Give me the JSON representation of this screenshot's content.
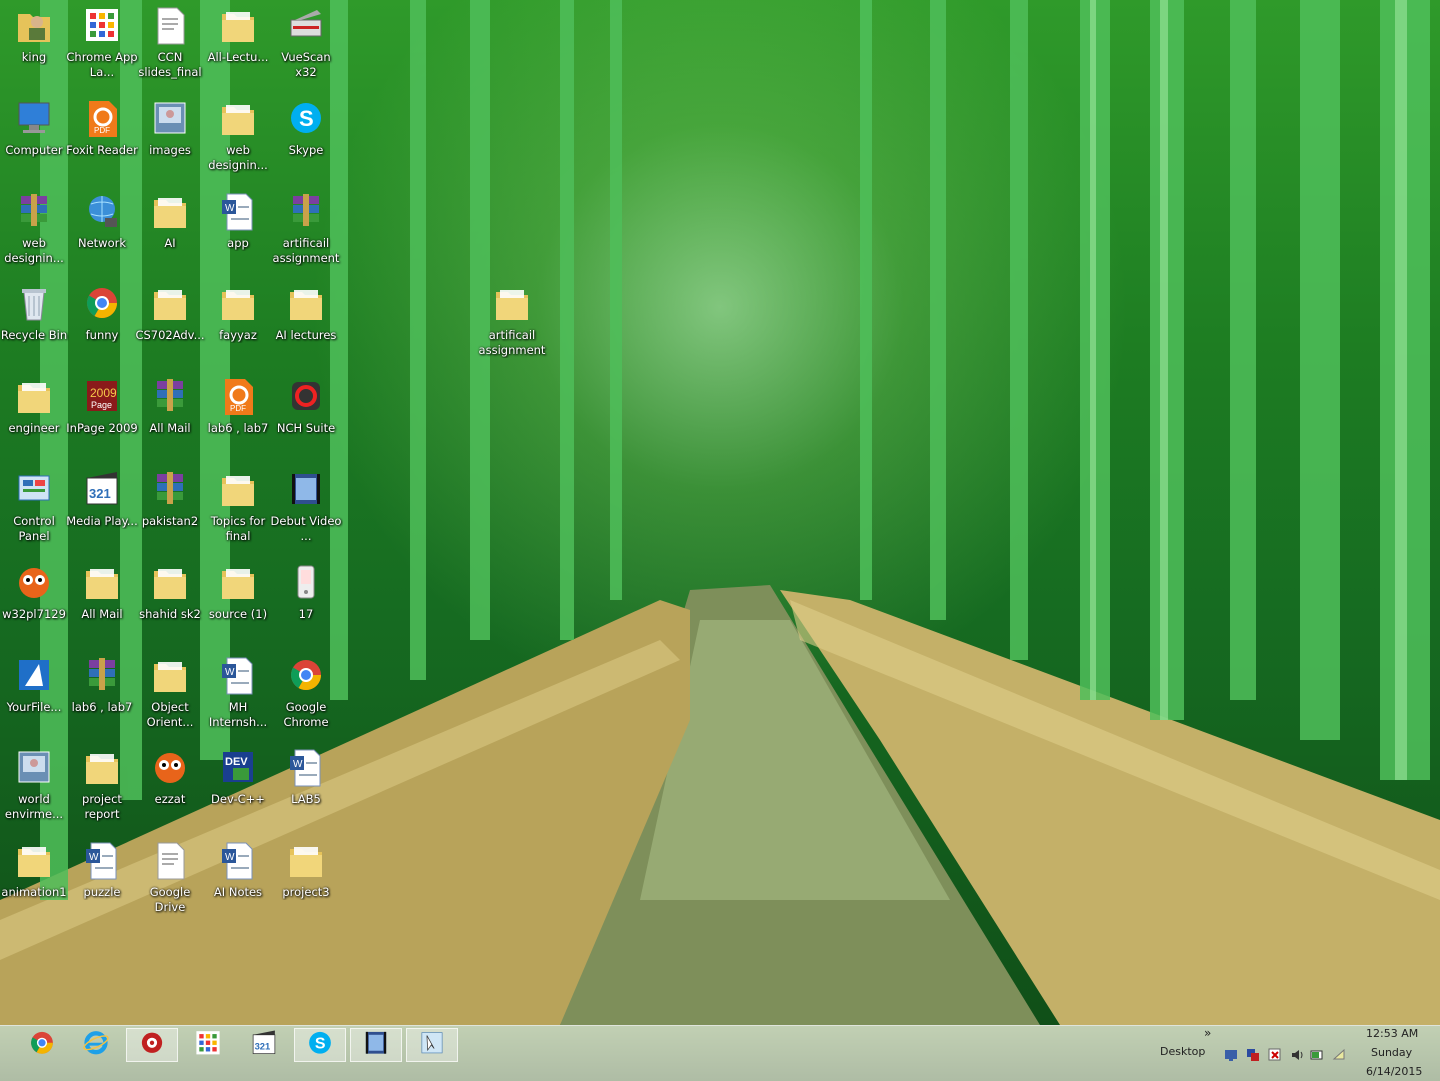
{
  "desktop_icons": [
    {
      "label": "king",
      "icon": "user-folder-icon"
    },
    {
      "label": "Chrome App La...",
      "icon": "chrome-apps-icon"
    },
    {
      "label": "CCN slides_final",
      "icon": "document-icon"
    },
    {
      "label": "All-Lectu...",
      "icon": "folder-icon"
    },
    {
      "label": "VueScan x32",
      "icon": "scanner-icon"
    },
    {
      "label": "Computer",
      "icon": "computer-icon"
    },
    {
      "label": "Foxit Reader",
      "icon": "foxit-icon"
    },
    {
      "label": "images",
      "icon": "image-icon"
    },
    {
      "label": "web designin...",
      "icon": "folder-icon"
    },
    {
      "label": "Skype",
      "icon": "skype-icon"
    },
    {
      "label": "web designin...",
      "icon": "winrar-icon"
    },
    {
      "label": "Network",
      "icon": "network-icon"
    },
    {
      "label": "AI",
      "icon": "folder-icon"
    },
    {
      "label": "app",
      "icon": "word-doc-icon"
    },
    {
      "label": "artificail assignment",
      "icon": "winrar-icon"
    },
    {
      "label": "Recycle Bin",
      "icon": "recycle-bin-icon"
    },
    {
      "label": "funny",
      "icon": "chrome-icon"
    },
    {
      "label": "CS702Adv...",
      "icon": "folder-icon"
    },
    {
      "label": "fayyaz",
      "icon": "folder-icon"
    },
    {
      "label": "AI lectures",
      "icon": "folder-icon"
    },
    {
      "label": "artificail assignment",
      "icon": "folder-icon"
    },
    {
      "label": "engineer",
      "icon": "folder-icon"
    },
    {
      "label": "InPage 2009",
      "icon": "inpage-icon"
    },
    {
      "label": "All Mail",
      "icon": "winrar-icon"
    },
    {
      "label": "lab6 , lab7",
      "icon": "foxit-icon"
    },
    {
      "label": "NCH Suite",
      "icon": "nch-icon"
    },
    {
      "label": "Control Panel",
      "icon": "control-panel-icon"
    },
    {
      "label": "Media Play...",
      "icon": "media-player-icon"
    },
    {
      "label": "pakistan2",
      "icon": "winrar-icon"
    },
    {
      "label": "Topics for final",
      "icon": "folder-icon"
    },
    {
      "label": "Debut Video ...",
      "icon": "film-icon"
    },
    {
      "label": "w32pl7129",
      "icon": "owl-icon"
    },
    {
      "label": "All Mail",
      "icon": "folder-icon"
    },
    {
      "label": "shahid sk2",
      "icon": "folder-icon"
    },
    {
      "label": "source (1)",
      "icon": "folder-icon"
    },
    {
      "label": "17",
      "icon": "phone-icon"
    },
    {
      "label": "YourFile...",
      "icon": "yourfile-icon"
    },
    {
      "label": "lab6 , lab7",
      "icon": "winrar-icon"
    },
    {
      "label": "Object Orient...",
      "icon": "folder-icon"
    },
    {
      "label": "MH Internsh...",
      "icon": "word-doc-icon"
    },
    {
      "label": "Google Chrome",
      "icon": "chrome-icon"
    },
    {
      "label": "world envirme...",
      "icon": "image-icon"
    },
    {
      "label": "project report",
      "icon": "folder-icon"
    },
    {
      "label": "ezzat",
      "icon": "owl-icon"
    },
    {
      "label": "Dev-C++",
      "icon": "devcpp-icon"
    },
    {
      "label": "LAB5",
      "icon": "word-doc-icon"
    },
    {
      "label": "animation1",
      "icon": "folder-icon"
    },
    {
      "label": "puzzle",
      "icon": "word-doc-icon"
    },
    {
      "label": "Google Drive",
      "icon": "document-icon"
    },
    {
      "label": "AI Notes",
      "icon": "word-doc-icon"
    },
    {
      "label": "project3",
      "icon": "folder-icon"
    }
  ],
  "taskbar": {
    "pinned": [
      {
        "icon": "chrome-icon"
      },
      {
        "icon": "internet-explorer-icon"
      },
      {
        "icon": "media-app-icon"
      },
      {
        "icon": "chrome-apps-icon"
      },
      {
        "icon": "media-player-icon"
      },
      {
        "icon": "skype-icon"
      },
      {
        "icon": "film-icon"
      },
      {
        "icon": "snipping-tool-icon"
      }
    ],
    "desktop_label": "Desktop",
    "overflow_glyph": "»",
    "time": "12:53 AM",
    "day": "Sunday",
    "date": "6/14/2015"
  }
}
